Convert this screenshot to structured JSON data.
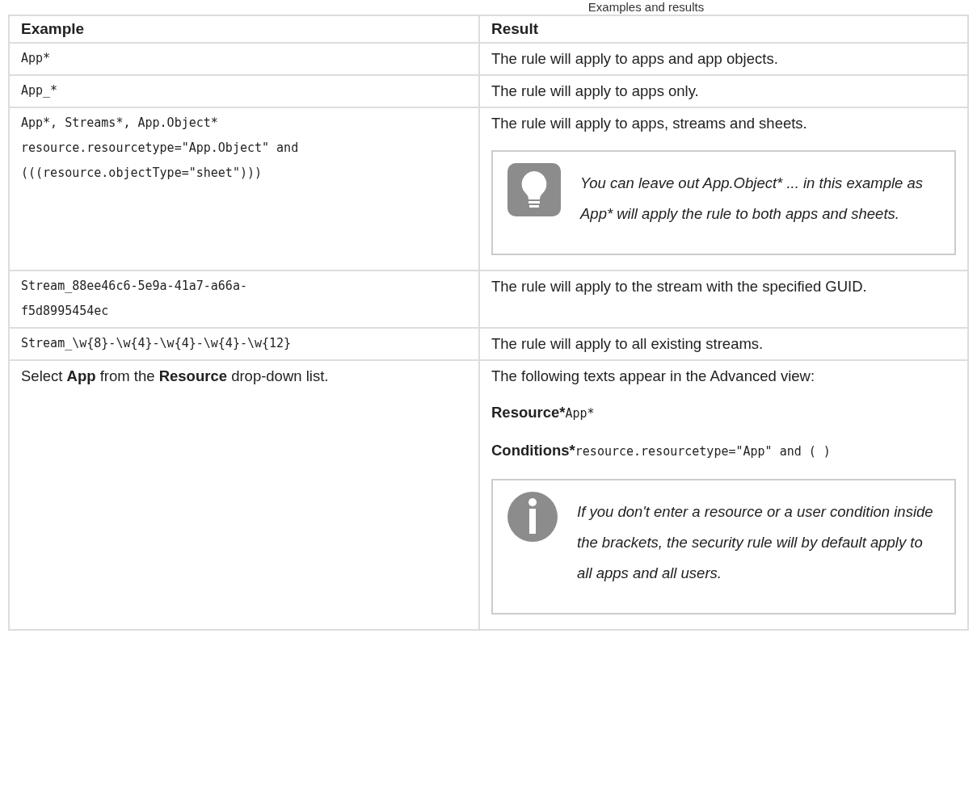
{
  "caption": "Examples and results",
  "table": {
    "columns": [
      "Example",
      "Result"
    ],
    "rows": [
      {
        "example": [
          {
            "kind": "code",
            "text": "App*"
          }
        ],
        "result": [
          {
            "kind": "text",
            "text": "The rule will apply to apps and app objects."
          }
        ]
      },
      {
        "example": [
          {
            "kind": "code",
            "text": "App_*"
          }
        ],
        "result": [
          {
            "kind": "text",
            "text": "The rule will apply to apps only."
          }
        ]
      },
      {
        "example": [
          {
            "kind": "code",
            "text": "App*, Streams*, App.Object*\nresource.resourcetype=\"App.Object\" and\n(((resource.objectType=\"sheet\")))"
          }
        ],
        "result": [
          {
            "kind": "text",
            "text": "The rule will apply to apps, streams and sheets."
          },
          {
            "kind": "tip_note",
            "text": "You can leave out App.Object* ... in this example as App* will apply the rule to both apps and sheets."
          }
        ]
      },
      {
        "example": [
          {
            "kind": "code",
            "text": "Stream_88ee46c6-5e9a-41a7-a66a-\nf5d8995454ec"
          }
        ],
        "result": [
          {
            "kind": "text",
            "text": "The rule will apply to the stream with the specified GUID."
          }
        ]
      },
      {
        "example": [
          {
            "kind": "code",
            "text": "Stream_\\w{8}-\\w{4}-\\w{4}-\\w{4}-\\w{12}"
          }
        ],
        "result": [
          {
            "kind": "text",
            "text": "The rule will apply to all existing streams."
          }
        ]
      },
      {
        "example": [
          {
            "kind": "text",
            "text": "Select **App** from the **Resource** drop-down list."
          }
        ],
        "result": [
          {
            "kind": "text",
            "text": "The following texts appear in the Advanced view:"
          },
          {
            "kind": "label_code",
            "label": "Resource*",
            "code": "App*"
          },
          {
            "kind": "label_code",
            "label": "Conditions*",
            "code": "resource.resourcetype=\"App\" and ( )"
          },
          {
            "kind": "info_note",
            "text": "If you don't enter a resource or a user condition inside the brackets, the security rule will by default apply to all apps and all users."
          }
        ]
      }
    ]
  }
}
